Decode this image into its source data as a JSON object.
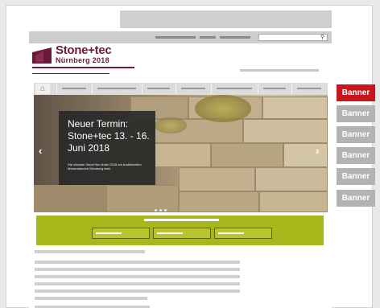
{
  "brand": {
    "name": "Stone+tec",
    "edition": "Nürnberg 2018"
  },
  "hero": {
    "title": "Neuer Termin: Stone+tec 13. - 16. Juni 2018",
    "text": "Die nächste Stone+tec findet 2018 am traditionellen Messestandort Nürnberg statt.",
    "prev_icon": "‹",
    "next_icon": "›"
  },
  "banners": [
    {
      "label": "Banner",
      "color": "#c8161d"
    },
    {
      "label": "Banner",
      "color": "#b3b3b3"
    },
    {
      "label": "Banner",
      "color": "#b3b3b3"
    },
    {
      "label": "Banner",
      "color": "#b3b3b3"
    },
    {
      "label": "Banner",
      "color": "#b3b3b3"
    },
    {
      "label": "Banner",
      "color": "#b3b3b3"
    }
  ],
  "colors": {
    "brand": "#6b1a3a",
    "accent_green": "#a8b71c",
    "banner_active": "#c8161d",
    "banner_inactive": "#b3b3b3"
  },
  "icons": {
    "search": "search-icon",
    "home": "home-icon"
  }
}
